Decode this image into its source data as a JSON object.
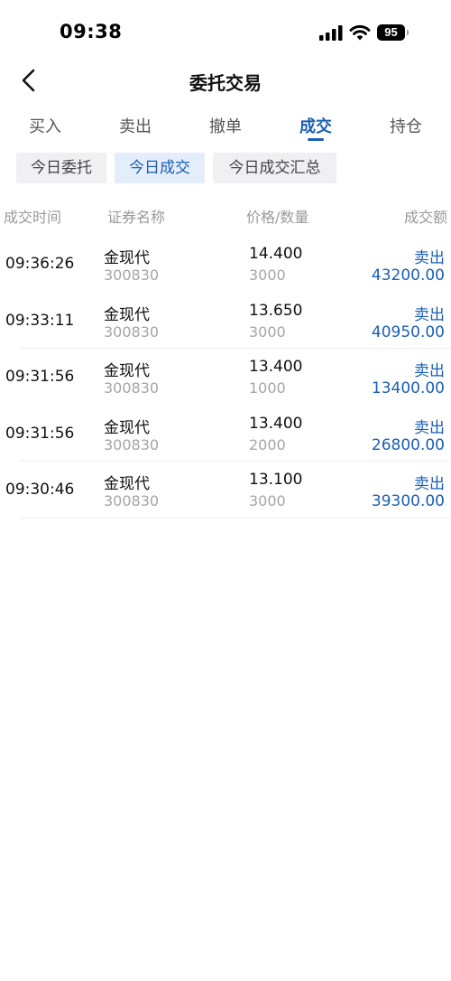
{
  "status_bar": {
    "time": "09:38",
    "battery": "95"
  },
  "nav": {
    "title": "委托交易"
  },
  "main_tabs": [
    {
      "label": "买入",
      "active": false
    },
    {
      "label": "卖出",
      "active": false
    },
    {
      "label": "撤单",
      "active": false
    },
    {
      "label": "成交",
      "active": true
    },
    {
      "label": "持仓",
      "active": false
    }
  ],
  "sub_tabs": [
    {
      "label": "今日委托",
      "active": false
    },
    {
      "label": "今日成交",
      "active": true
    },
    {
      "label": "今日成交汇总",
      "active": false
    }
  ],
  "table": {
    "headers": {
      "time": "成交时间",
      "name": "证券名称",
      "price_qty": "价格/数量",
      "amount": "成交额"
    },
    "rows": [
      {
        "time": "09:36:26",
        "name": "金现代",
        "code": "300830",
        "price": "14.400",
        "qty": "3000",
        "action": "卖出",
        "amount": "43200.00"
      },
      {
        "time": "09:33:11",
        "name": "金现代",
        "code": "300830",
        "price": "13.650",
        "qty": "3000",
        "action": "卖出",
        "amount": "40950.00"
      },
      {
        "time": "09:31:56",
        "name": "金现代",
        "code": "300830",
        "price": "13.400",
        "qty": "1000",
        "action": "卖出",
        "amount": "13400.00"
      },
      {
        "time": "09:31:56",
        "name": "金现代",
        "code": "300830",
        "price": "13.400",
        "qty": "2000",
        "action": "卖出",
        "amount": "26800.00"
      },
      {
        "time": "09:30:46",
        "name": "金现代",
        "code": "300830",
        "price": "13.100",
        "qty": "3000",
        "action": "卖出",
        "amount": "39300.00"
      }
    ]
  },
  "colors": {
    "accent": "#1a5fb4",
    "muted": "#9a9a9a",
    "sub_tab_bg": "#f0f0f2",
    "sub_tab_active_bg": "#e4eefb"
  },
  "icons": {
    "back": "chevron-left-icon",
    "signal": "cellular-signal-icon",
    "wifi": "wifi-icon",
    "battery": "battery-icon"
  }
}
